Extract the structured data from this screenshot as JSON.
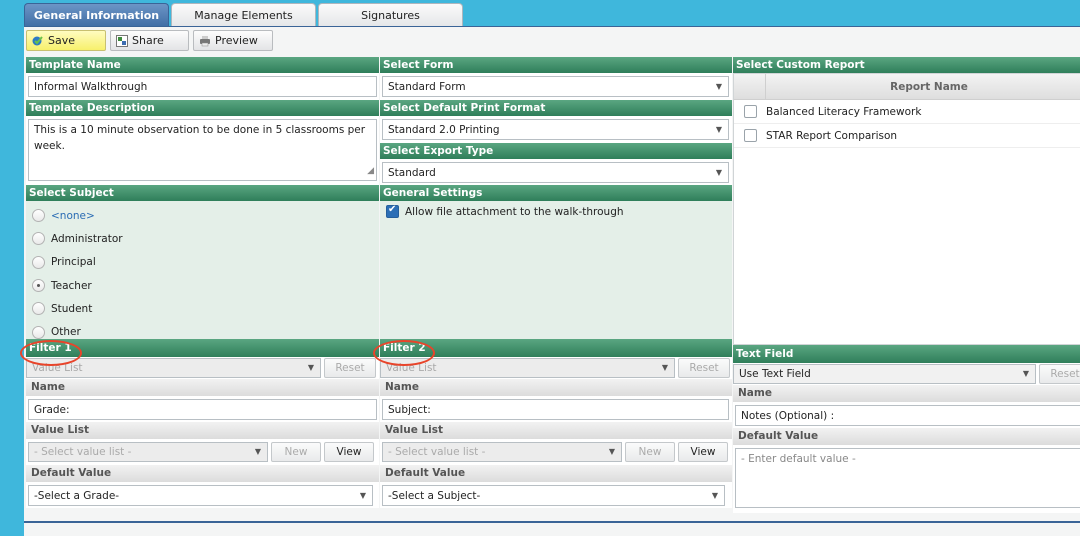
{
  "tabs": [
    {
      "label": "General Information",
      "active": true
    },
    {
      "label": "Manage Elements",
      "active": false
    },
    {
      "label": "Signatures",
      "active": false
    }
  ],
  "toolbar": {
    "save": "Save",
    "share": "Share",
    "preview": "Preview"
  },
  "template_name": {
    "header": "Template Name",
    "value": "Informal Walkthrough"
  },
  "template_description": {
    "header": "Template Description",
    "value": "This is a 10 minute observation to be done in 5 classrooms per week."
  },
  "select_form": {
    "header": "Select Form",
    "value": "Standard Form"
  },
  "print_format": {
    "header": "Select Default Print Format",
    "value": "Standard 2.0 Printing"
  },
  "export_type": {
    "header": "Select Export Type",
    "value": "Standard"
  },
  "custom_report": {
    "header": "Select Custom Report",
    "column": "Report Name",
    "rows": [
      "Balanced Literacy Framework",
      "STAR Report Comparison"
    ]
  },
  "subject": {
    "header": "Select Subject",
    "options": [
      "<none>",
      "Administrator",
      "Principal",
      "Teacher",
      "Student",
      "Other"
    ],
    "selected": "Teacher"
  },
  "general_settings": {
    "header": "General Settings",
    "allow_attachment": "Allow file attachment to the walk-through"
  },
  "filter1": {
    "header": "Filter 1",
    "type": "Value List",
    "reset": "Reset",
    "name_label": "Name",
    "name": "Grade:",
    "value_list_label": "Value List",
    "value_list": "- Select value list -",
    "new": "New",
    "view": "View",
    "default_label": "Default Value",
    "default": "-Select a Grade-"
  },
  "filter2": {
    "header": "Filter 2",
    "type": "Value List",
    "reset": "Reset",
    "name_label": "Name",
    "name": "Subject:",
    "value_list_label": "Value List",
    "value_list": "- Select value list -",
    "new": "New",
    "view": "View",
    "default_label": "Default Value",
    "default": "-Select a Subject-"
  },
  "text_field": {
    "header": "Text Field",
    "type": "Use Text Field",
    "reset": "Reset",
    "name_label": "Name",
    "name": "Notes (Optional) :",
    "default_label": "Default Value",
    "default_placeholder": "- Enter default value -"
  }
}
